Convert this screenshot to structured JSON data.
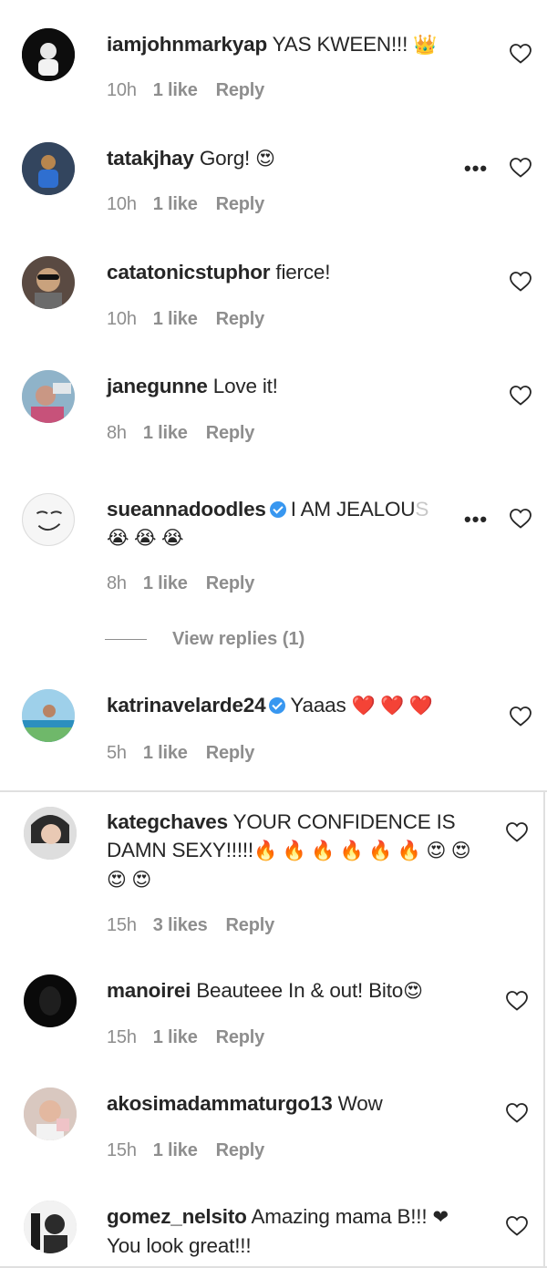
{
  "comments": [
    {
      "username": "iamjohnmarkyap",
      "text": "YAS KWEEN!!! ",
      "emoji": "👑",
      "time": "10h",
      "likes": "1 like",
      "reply": "Reply"
    },
    {
      "username": "tatakjhay",
      "text": "Gorg! ",
      "emoji": "😍",
      "time": "10h",
      "likes": "1 like",
      "reply": "Reply",
      "more": "•••"
    },
    {
      "username": "catatonicstuphor",
      "text": "fierce!",
      "time": "10h",
      "likes": "1 like",
      "reply": "Reply"
    },
    {
      "username": "janegunne",
      "text": "Love it!",
      "time": "8h",
      "likes": "1 like",
      "reply": "Reply"
    },
    {
      "username": "sueannadoodles",
      "text": "I AM JEALOU",
      "text_faded": "S",
      "emoji_line": "😭 😭 😭",
      "time": "8h",
      "likes": "1 like",
      "reply": "Reply",
      "more": "•••"
    },
    {
      "username": "katrinavelarde24",
      "text": "Yaaas ",
      "emoji": "❤️ ❤️ ❤️",
      "time": "5h",
      "likes": "1 like",
      "reply": "Reply"
    },
    {
      "username": "kategchaves",
      "text": "YOUR CONFIDENCE IS DAMN SEXY!!!!!",
      "emoji": "🔥 🔥 🔥 🔥 🔥 🔥 😍 😍 😍 😍",
      "time": "15h",
      "likes": "3 likes",
      "reply": "Reply"
    },
    {
      "username": "manoirei",
      "text": "Beauteee In & out! Bito",
      "emoji": "😍",
      "time": "15h",
      "likes": "1 like",
      "reply": "Reply"
    },
    {
      "username": "akosimadammaturgo13",
      "text": "Wow",
      "time": "15h",
      "likes": "1 like",
      "reply": "Reply"
    },
    {
      "username": "gomez_nelsito",
      "text": "Amazing mama B!!! ",
      "emoji": "❤",
      "text2": "You look great!!!"
    }
  ],
  "view_replies": "View replies (1)"
}
